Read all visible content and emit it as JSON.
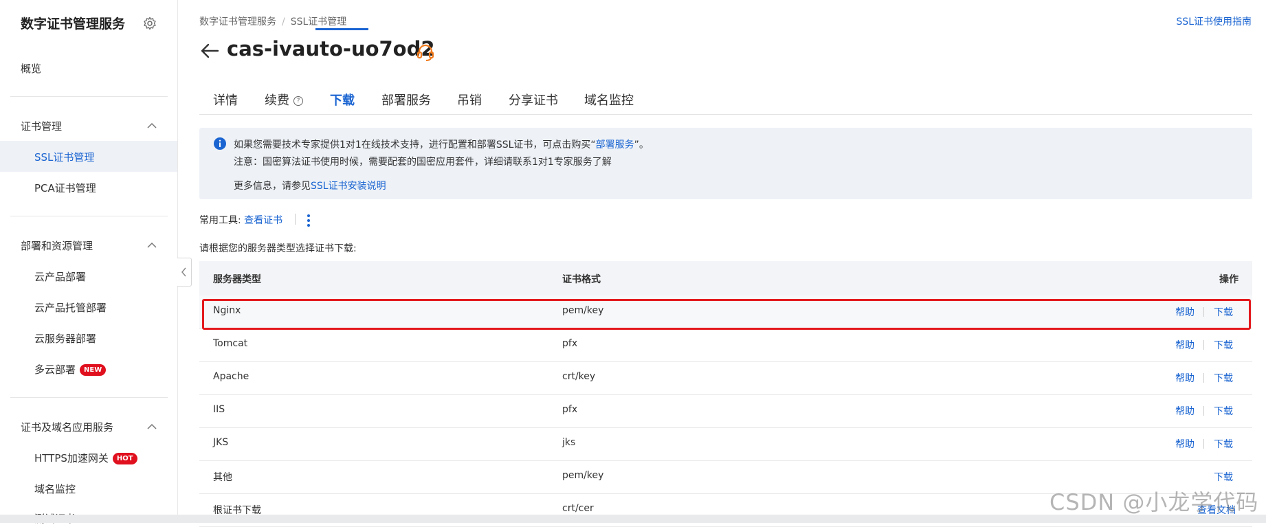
{
  "sidebar": {
    "title": "数字证书管理服务",
    "overview": "概览",
    "groups": [
      {
        "label": "证书管理",
        "items": [
          "SSL证书管理",
          "PCA证书管理"
        ]
      },
      {
        "label": "部署和资源管理",
        "items": [
          "云产品部署",
          "云产品托管部署",
          "云服务器部署",
          "多云部署"
        ]
      },
      {
        "label": "证书及域名应用服务",
        "items": [
          "HTTPS加速网关",
          "域名监控",
          "测试证书"
        ]
      }
    ],
    "badges": {
      "new": "NEW",
      "hot": "HOT"
    }
  },
  "breadcrumb": [
    "数字证书管理服务",
    "SSL证书管理"
  ],
  "guide_link": "SSL证书使用指南",
  "title": "cas-ivauto-uo7od2",
  "tabs": [
    "详情",
    "续费",
    "下载",
    "部署服务",
    "吊销",
    "分享证书",
    "域名监控"
  ],
  "active_tab": "下载",
  "notice": {
    "line1_prefix": "如果您需要技术专家提供1对1在线技术支持，进行配置和部署SSL证书，可点击购买“",
    "line1_link": "部署服务",
    "line1_suffix": "”。",
    "line2": "注意：国密算法证书使用时候，需要配套的国密应用套件，详细请联系1对1专家服务了解",
    "line3_prefix": "更多信息，请参见",
    "line3_link": "SSL证书安装说明"
  },
  "tools": {
    "label": "常用工具:",
    "view_cert": "查看证书"
  },
  "select_hint": "请根据您的服务器类型选择证书下载:",
  "table": {
    "headers": {
      "server": "服务器类型",
      "format": "证书格式",
      "action": "操作"
    },
    "rows": [
      {
        "server": "Nginx",
        "format": "pem/key",
        "help": "帮助",
        "download": "下载"
      },
      {
        "server": "Tomcat",
        "format": "pfx",
        "help": "帮助",
        "download": "下载"
      },
      {
        "server": "Apache",
        "format": "crt/key",
        "help": "帮助",
        "download": "下载"
      },
      {
        "server": "IIS",
        "format": "pfx",
        "help": "帮助",
        "download": "下载"
      },
      {
        "server": "JKS",
        "format": "jks",
        "help": "帮助",
        "download": "下载"
      },
      {
        "server": "其他",
        "format": "pem/key",
        "help": "",
        "download": "下载"
      },
      {
        "server": "根证书下载",
        "format": "crt/cer",
        "help": "",
        "download": "查看文档"
      }
    ]
  },
  "watermark": "CSDN @小龙学代码",
  "colors": {
    "accent": "#1a64d1",
    "highlight": "#e3191d",
    "badge": "#e0101e",
    "headset": "#f07b1e"
  }
}
